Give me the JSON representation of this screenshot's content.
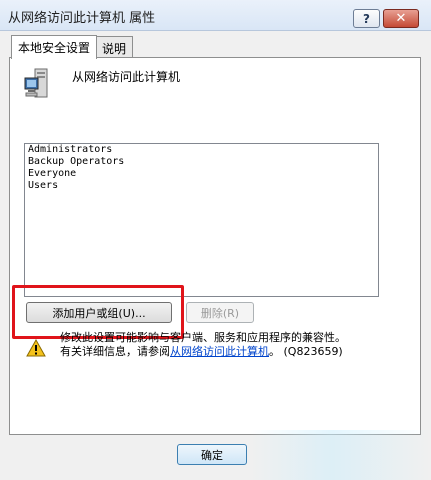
{
  "window": {
    "title": "从网络访问此计算机 属性",
    "help_label": "?",
    "close_label": "✕"
  },
  "tabs": [
    {
      "label": "本地安全设置",
      "active": true
    },
    {
      "label": "说明",
      "active": false
    }
  ],
  "policy": {
    "icon": "computer-icon",
    "title": "从网络访问此计算机"
  },
  "members": [
    "Administrators",
    "Backup Operators",
    "Everyone",
    "Users"
  ],
  "buttons": {
    "add": "添加用户或组(U)...",
    "remove": "删除(R)",
    "ok": "确定"
  },
  "warning": {
    "icon": "warning-icon",
    "line1": "修改此设置可能影响与客户端、服务和应用程序的兼容性。",
    "line2_prefix": "有关详细信息，请参阅",
    "link": "从网络访问此计算机",
    "line2_suffix": "。 (Q823659)"
  },
  "colors": {
    "highlight": "#e0141a",
    "link": "#0044cc"
  }
}
